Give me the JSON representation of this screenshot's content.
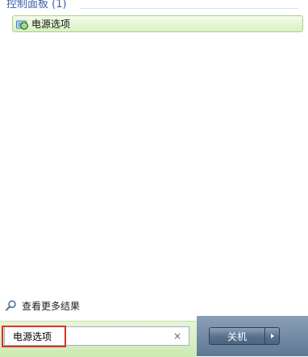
{
  "results": {
    "group_header": "控制面板 (1)",
    "items": [
      {
        "label": "电源选项",
        "icon": "power-options-icon"
      }
    ],
    "see_more": "查看更多结果"
  },
  "search": {
    "value": "电源选项",
    "clear_glyph": "×"
  },
  "shutdown": {
    "label": "关机"
  }
}
